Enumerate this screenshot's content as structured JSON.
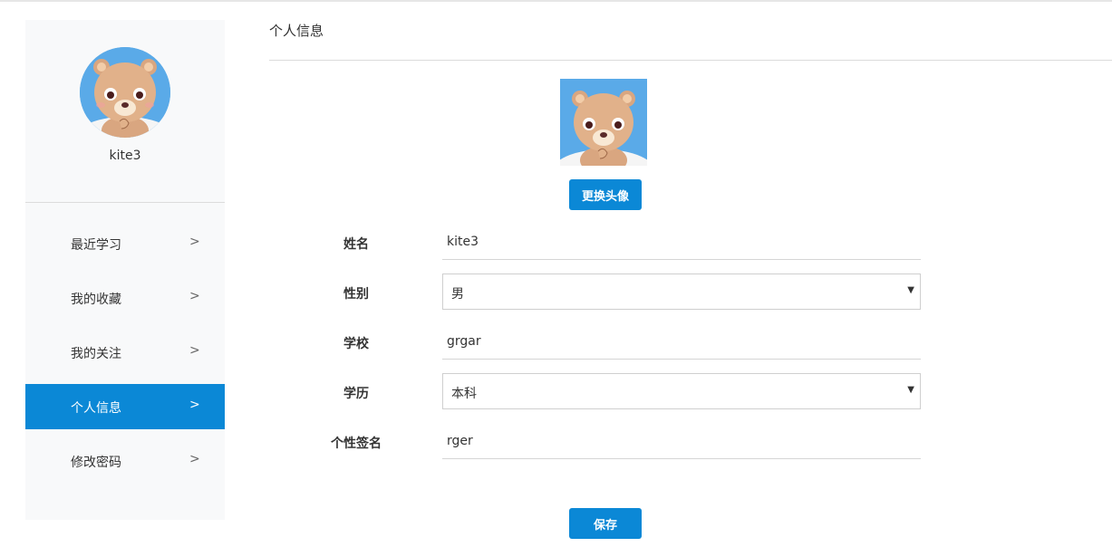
{
  "sidebar": {
    "username": "kite3",
    "nav": [
      {
        "label": "最近学习",
        "arrow": ">"
      },
      {
        "label": "我的收藏",
        "arrow": ">"
      },
      {
        "label": "我的关注",
        "arrow": ">"
      },
      {
        "label": "个人信息",
        "arrow": ">"
      },
      {
        "label": "修改密码",
        "arrow": ">"
      }
    ],
    "active_index": 3
  },
  "main": {
    "title": "个人信息",
    "change_avatar_label": "更换头像",
    "fields": {
      "name": {
        "label": "姓名",
        "value": "kite3"
      },
      "gender": {
        "label": "性别",
        "value": "男"
      },
      "school": {
        "label": "学校",
        "value": "grgar"
      },
      "education": {
        "label": "学历",
        "value": "本科"
      },
      "signature": {
        "label": "个性签名",
        "value": "rger"
      }
    },
    "save_label": "保存"
  },
  "colors": {
    "accent": "#0b88d6",
    "sidebar_bg": "#f8f9fa",
    "avatar_bg": "#5aaae8"
  },
  "icons": {
    "avatar": "bear-avatar-icon",
    "select_caret": "caret-down-icon"
  }
}
